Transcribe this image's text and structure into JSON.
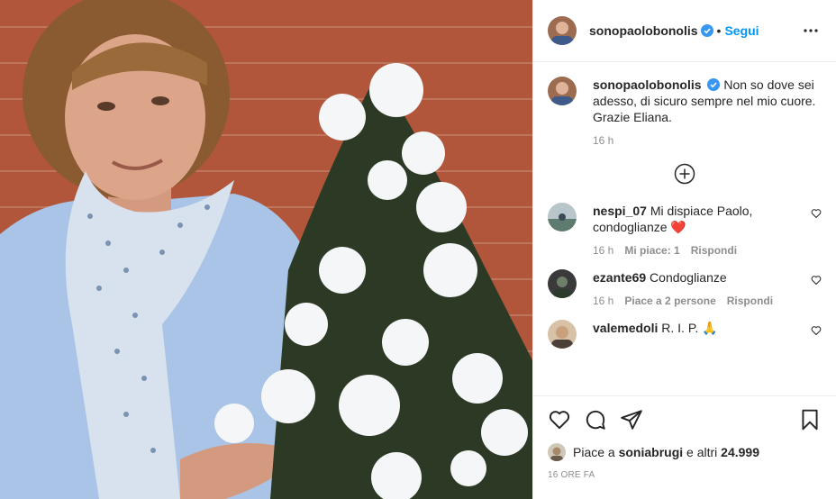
{
  "header": {
    "username": "sonopaolobonolis",
    "dot": "•",
    "follow": "Segui"
  },
  "caption": {
    "username": "sonopaolobonolis",
    "text": "Non so dove sei adesso, di sicuro sempre nel mio cuore. Grazie Eliana.",
    "time": "16 h"
  },
  "comments": [
    {
      "username": "nespi_07",
      "text": "Mi dispiace Paolo, condoglianze",
      "time": "16 h",
      "likes": "Mi piace: 1",
      "reply": "Rispondi",
      "emoji": "❤️"
    },
    {
      "username": "ezante69",
      "text": "Condoglianze",
      "time": "16 h",
      "likes": "Piace a 2 persone",
      "reply": "Rispondi"
    },
    {
      "username": "valemedoli",
      "text": "R. I. P. 🙏"
    }
  ],
  "actions": {
    "likes_prefix": "Piace a",
    "likes_user": "soniabrugi",
    "likes_suffix": "e altri",
    "likes_count": "24.999",
    "time": "16 ORE FA"
  },
  "colors": {
    "accent": "#0095f6",
    "heart": "#ed4956",
    "muted": "#8e8e8e"
  }
}
